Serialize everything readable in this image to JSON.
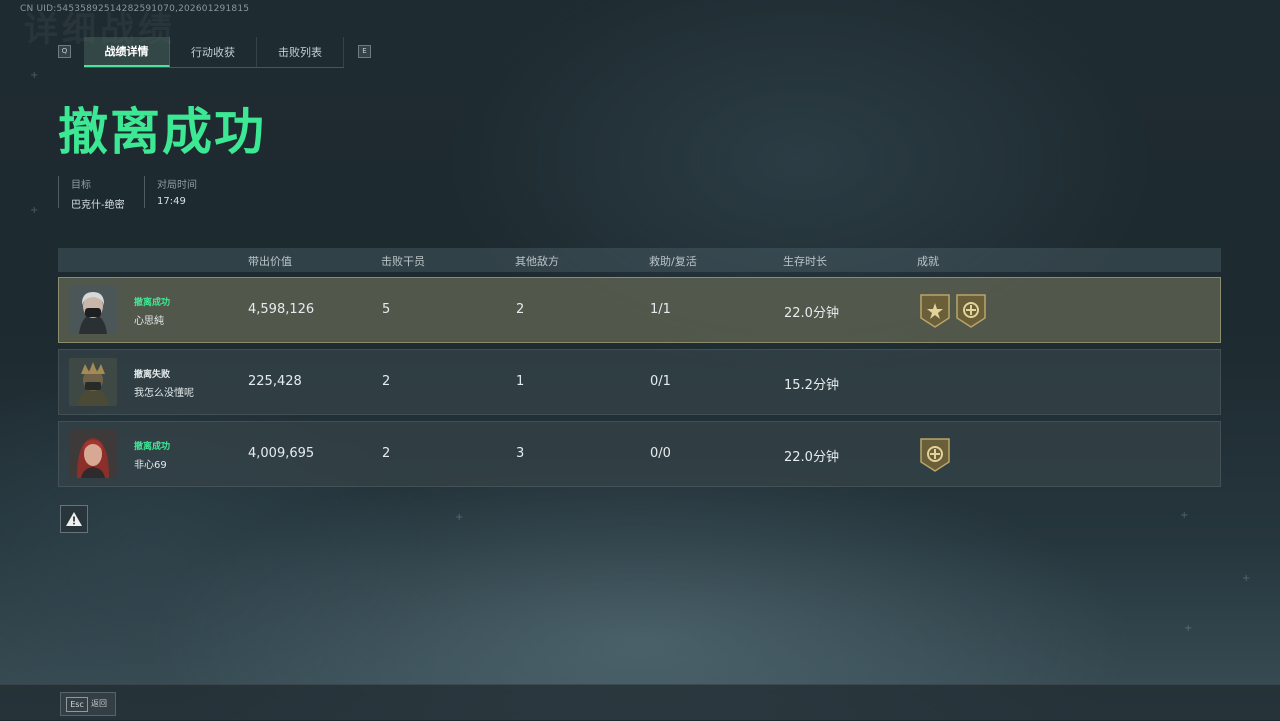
{
  "uid": "CN UID:545358925142825910 70,202601291815",
  "ghost_title": "详细战绩",
  "keys": {
    "prev": "Q",
    "next": "E"
  },
  "tabs": [
    {
      "label": "战绩详情",
      "active": true
    },
    {
      "label": "行动收获",
      "active": false
    },
    {
      "label": "击败列表",
      "active": false
    }
  ],
  "result_title": "撤离成功",
  "meta": [
    {
      "label": "目标",
      "value": "巴克什-绝密"
    },
    {
      "label": "对局时间",
      "value": "17:49"
    }
  ],
  "columns": [
    "带出价值",
    "击败干员",
    "其他敌方",
    "救助/复活",
    "生存时长",
    "成就"
  ],
  "players": [
    {
      "status": "撤离成功",
      "status_color": "#3de894",
      "name": "心思純",
      "value": "4,598,126",
      "kills": "5",
      "other": "2",
      "assist": "1/1",
      "survival": "22.0分钟",
      "medals": [
        "star-medal-icon",
        "cross-medal-icon"
      ],
      "highlight": true
    },
    {
      "status": "撤离失败",
      "status_color": "#e6ecee",
      "name": "我怎么没懂呢",
      "value": "225,428",
      "kills": "2",
      "other": "1",
      "assist": "0/1",
      "survival": "15.2分钟",
      "medals": [],
      "highlight": false
    },
    {
      "status": "撤离成功",
      "status_color": "#3de894",
      "name": "非心69",
      "value": "4,009,695",
      "kills": "2",
      "other": "3",
      "assist": "0/0",
      "survival": "22.0分钟",
      "medals": [
        "cross-medal-icon"
      ],
      "highlight": false
    }
  ],
  "bottom": {
    "key": "Esc",
    "label": "返回"
  }
}
